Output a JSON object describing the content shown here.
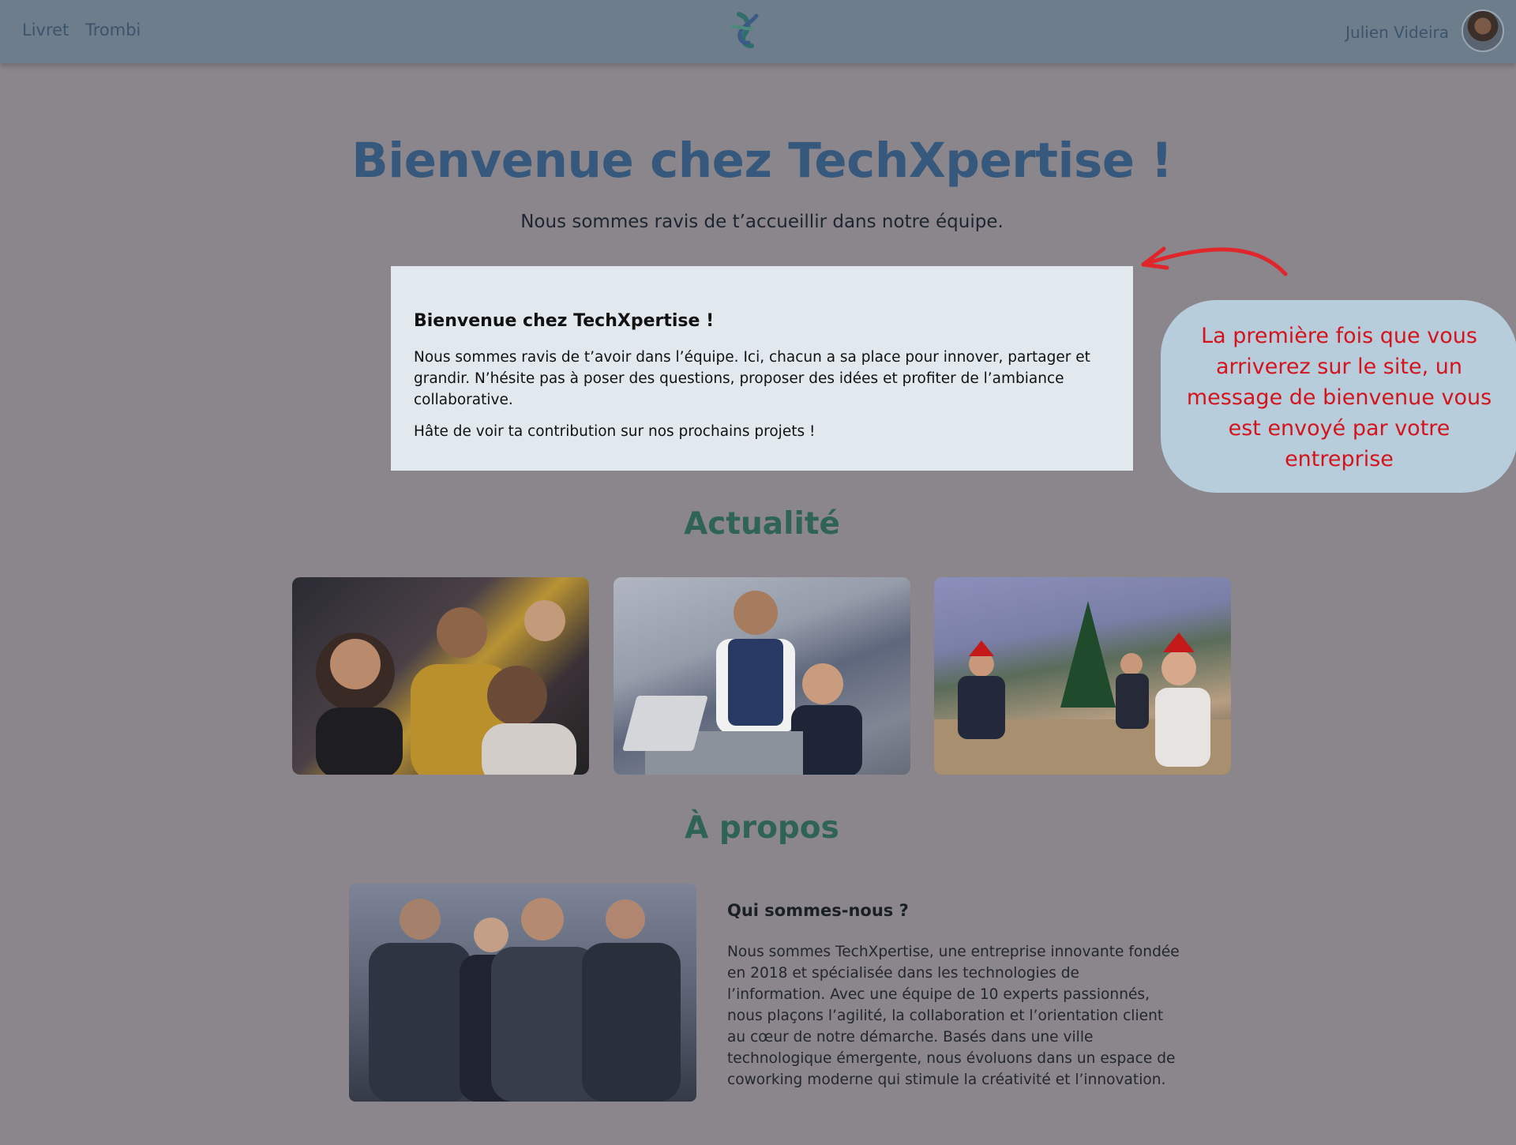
{
  "header": {
    "nav": [
      {
        "label": "Livret"
      },
      {
        "label": "Trombi"
      }
    ],
    "user_name": "Julien Videira",
    "logo_icon": "stylized-tx-logo-icon",
    "avatar_icon": "user-avatar-photo"
  },
  "hero": {
    "title": "Bienvenue chez TechXpertise !",
    "subtitle": "Nous sommes ravis de t’accueillir dans notre équipe."
  },
  "welcome_box": {
    "title": "Bienvenue chez TechXpertise !",
    "paragraph1": "Nous sommes ravis de t’avoir dans l’équipe. Ici, chacun a sa place pour innover, partager et grandir. N’hésite pas à poser des questions, proposer des idées et profiter de l’ambiance collaborative.",
    "paragraph2": "Hâte de voir ta contribution sur nos prochains projets !"
  },
  "annotation": {
    "text": "La première fois que vous arriverez sur le site, un message de bienvenue vous est envoyé par votre entreprise",
    "color": "#d4141c"
  },
  "news": {
    "title": "Actualité",
    "images": [
      {
        "icon": "team-celebration-photo"
      },
      {
        "icon": "office-laptop-photo"
      },
      {
        "icon": "christmas-meeting-photo"
      }
    ]
  },
  "about": {
    "title": "À propos",
    "subtitle": "Qui sommes-nous ?",
    "text": "Nous sommes TechXpertise, une entreprise innovante fondée en 2018 et spécialisée dans les technologies de l’information. Avec une équipe de 10 experts passionnés, nous plaçons l’agilité, la collaboration et l’orientation client au cœur de notre démarche. Basés dans une ville technologique émergente, nous évoluons dans un espace de coworking moderne qui stimule la créativité et l’innovation.",
    "image_icon": "business-team-photo"
  },
  "colors": {
    "header_bg": "#6e7d8b",
    "page_overlay": "#8a868b",
    "hero_title": "#36587c",
    "section_title": "#2f6356",
    "welcome_bg": "#e1e8ee",
    "callout_bg": "#b8cddc"
  }
}
